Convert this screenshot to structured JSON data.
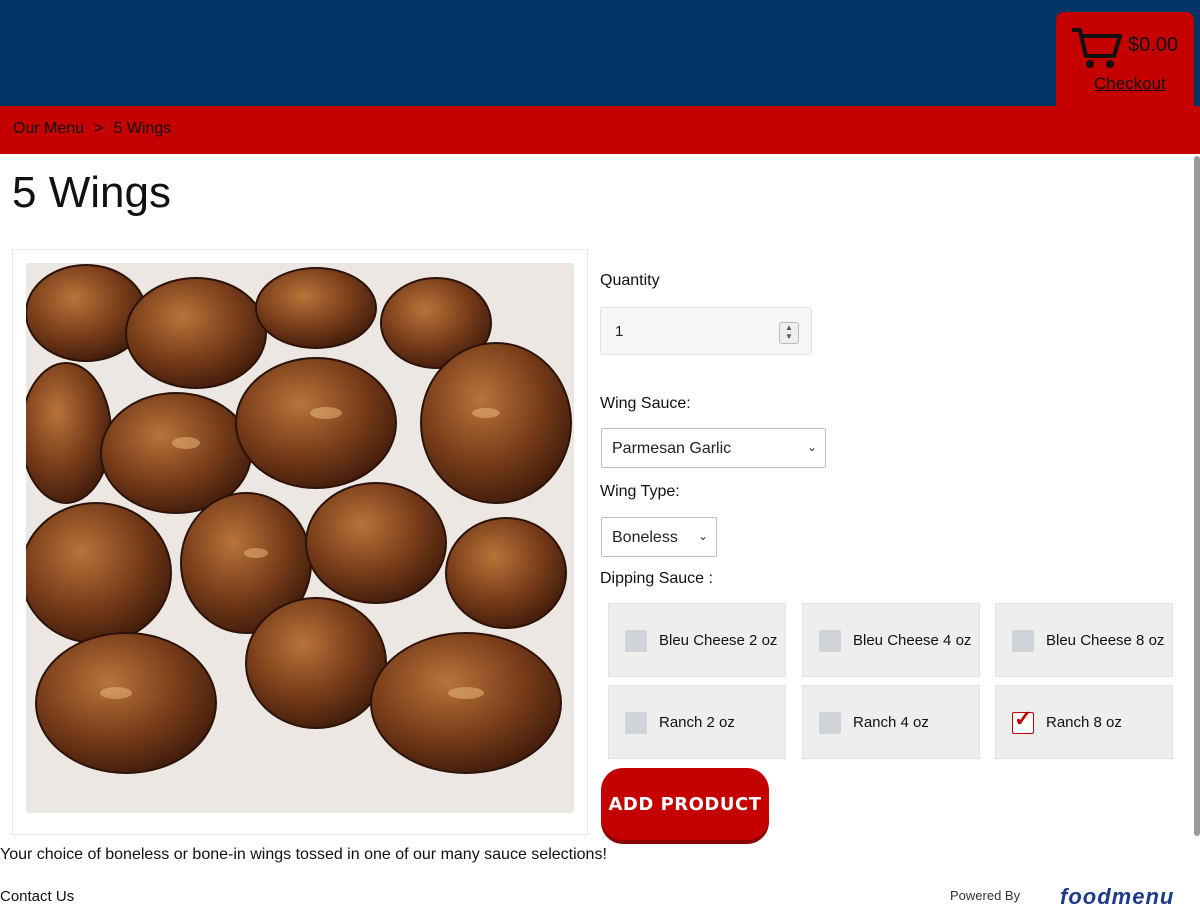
{
  "header": {
    "cart": {
      "icon": "shopping-cart-icon",
      "total": "$0.00",
      "checkout_label": "Checkout"
    }
  },
  "breadcrumb": {
    "items": [
      "Our Menu",
      "5 Wings"
    ],
    "separator": ">"
  },
  "product": {
    "title": "5 Wings",
    "image_alt": "boneless wings in sauce",
    "description": "Your choice of boneless or bone-in wings tossed in one of our many sauce selections!"
  },
  "form": {
    "quantity_label": "Quantity",
    "quantity_value": "1",
    "wing_sauce_label": "Wing Sauce:",
    "wing_sauce_value": "Parmesan Garlic",
    "wing_type_label": "Wing Type:",
    "wing_type_value": "Boneless",
    "dipping_label": "Dipping Sauce :",
    "dipping_options": [
      {
        "label": "Bleu Cheese 2 oz",
        "checked": false
      },
      {
        "label": "Bleu Cheese 4 oz",
        "checked": false
      },
      {
        "label": "Bleu Cheese 8 oz",
        "checked": false
      },
      {
        "label": "Ranch 2 oz",
        "checked": false
      },
      {
        "label": "Ranch 4 oz",
        "checked": false
      },
      {
        "label": "Ranch 8 oz",
        "checked": true
      }
    ],
    "add_button": "ADD PRODUCT"
  },
  "footer": {
    "contact": "Contact Us",
    "powered_by": "Powered By",
    "brand": "foodmenu"
  },
  "colors": {
    "header_blue": "#003366",
    "accent_red": "#c40000"
  }
}
